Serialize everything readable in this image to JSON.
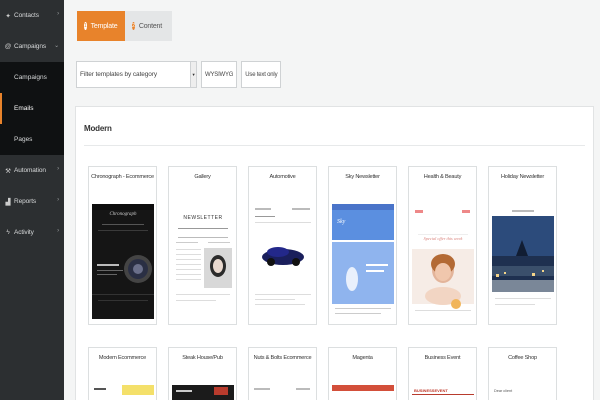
{
  "sidebar": {
    "items": [
      {
        "label": "Contacts",
        "icon": "user-icon"
      },
      {
        "label": "Campaigns",
        "icon": "at-icon"
      },
      {
        "label": "Automation",
        "icon": "wrench-icon"
      },
      {
        "label": "Reports",
        "icon": "bar-chart-icon"
      },
      {
        "label": "Activity",
        "icon": "pulse-icon"
      }
    ],
    "subitems": [
      "Campaigns",
      "Emails",
      "Pages"
    ]
  },
  "tabs": [
    {
      "num": "1",
      "label": "Template"
    },
    {
      "num": "2",
      "label": "Content"
    }
  ],
  "filters": {
    "category_placeholder": "Filter templates by category",
    "wysiwyg_label": "WYSIWYG",
    "text_only_label": "Use text only"
  },
  "panel": {
    "title": "Modern"
  },
  "templates_row1": [
    "Chronograph - Ecommerce",
    "Gallery",
    "Automotive",
    "Sky Newsletter",
    "Health & Beauty",
    "Holiday Newsletter"
  ],
  "templates_row2": [
    "Modern Ecommerce",
    "Steak House/Pub",
    "Nuts & Bolts Ecommerce",
    "Magenta",
    "Business Event",
    "Coffee Shop"
  ],
  "thumb_text": {
    "gallery_heading": "NEWSLETTER",
    "chrono_brand": "Chronograph",
    "sky_brand": "Sky",
    "health_tagline": "Special offer this week",
    "business_event_brand": "BUSINESSEVENT",
    "coffee_line": "Dear client"
  },
  "colors": {
    "accent": "#e8832b",
    "sidebar_bg": "#2c2f31",
    "sidebar_sub_bg": "#0f1112"
  }
}
